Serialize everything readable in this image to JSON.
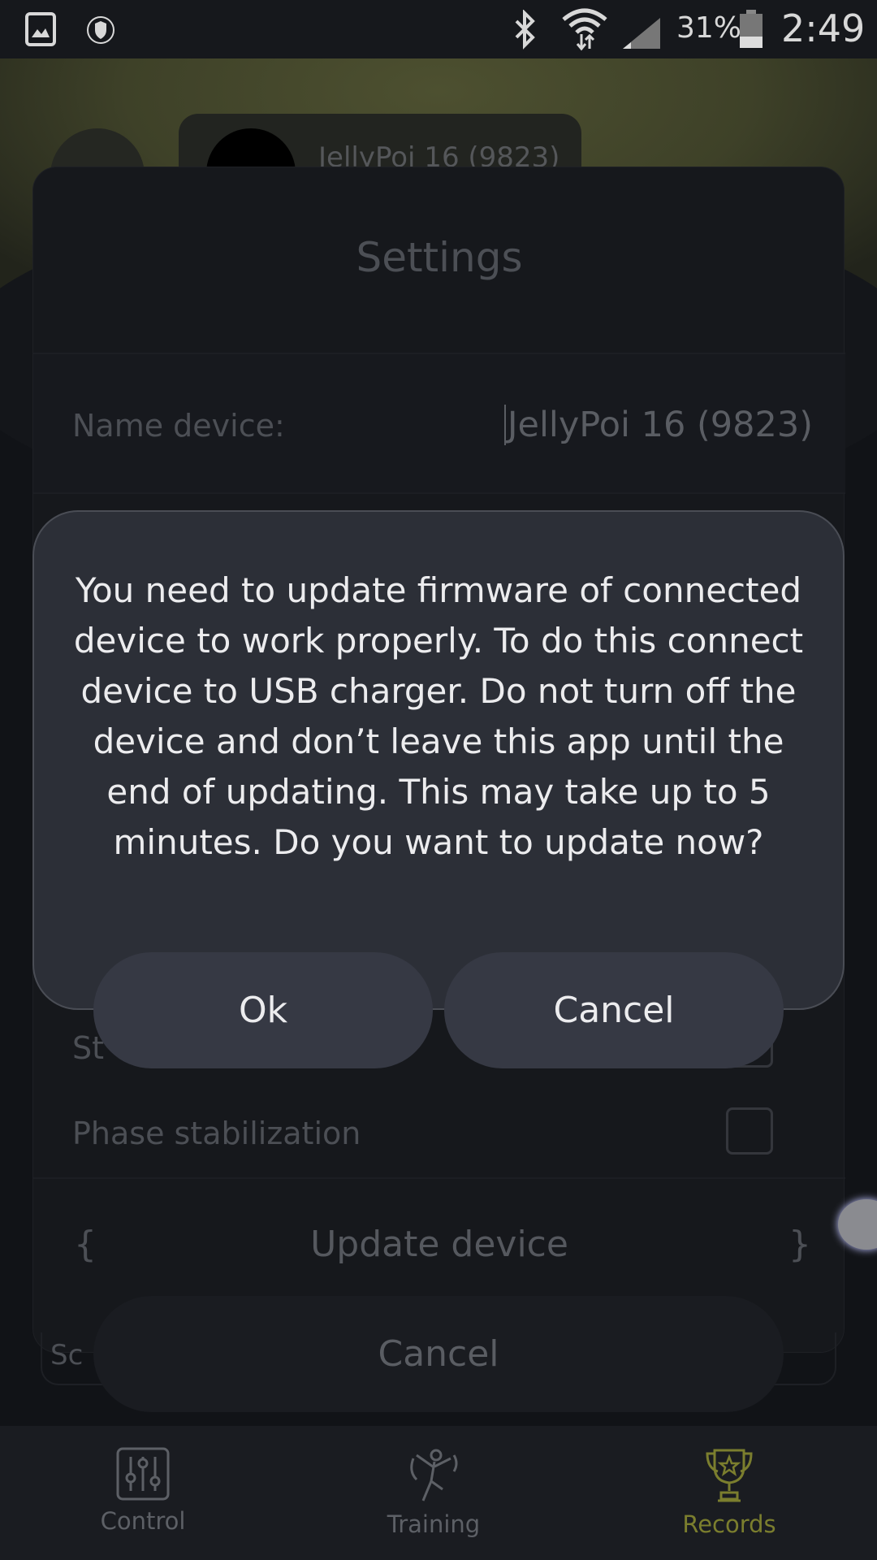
{
  "status_bar": {
    "battery": "31%",
    "time": "2:49",
    "icons": [
      "gallery-icon",
      "vpn-shield-icon",
      "bluetooth-icon",
      "wifi-icon",
      "signal-icon",
      "battery-icon"
    ]
  },
  "device_header": {
    "device_name": "JellyPoi 16 (9823)"
  },
  "settings": {
    "title": "Settings",
    "name_device_label": "Name device:",
    "name_device_value": "JellyPoi 16 (9823)",
    "partial_row_label": "St",
    "phase_stabilization_label": "Phase stabilization",
    "phase_stabilization_checked": false,
    "update_device_label": "Update device",
    "brace_left": "{",
    "brace_right": "}",
    "partial_bottom_label": "Sc",
    "cancel_label": "Cancel"
  },
  "dialog": {
    "message": "You need to update firmware of connected device to work properly. To do this connect device to USB charger. Do not turn off the device and don’t leave this app until the end of updating. This may take up to 5 minutes. Do you want to update now?",
    "ok_label": "Ok",
    "cancel_label": "Cancel"
  },
  "bottom_nav": {
    "items": [
      {
        "label": "Control",
        "icon": "sliders-icon"
      },
      {
        "label": "Training",
        "icon": "juggler-icon"
      },
      {
        "label": "Records",
        "icon": "trophy-icon",
        "active": true
      }
    ],
    "active_color": "#7b7e2e"
  }
}
